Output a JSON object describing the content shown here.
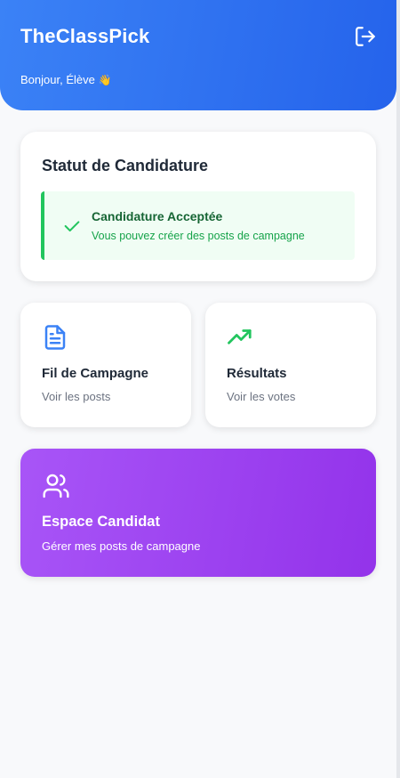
{
  "header": {
    "app_title": "TheClassPick",
    "greeting": "Bonjour, Élève",
    "greeting_emoji": "👋",
    "logout_icon": "logout-icon"
  },
  "status": {
    "title": "Statut de Candidature",
    "heading": "Candidature Acceptée",
    "message": "Vous pouvez créer des posts de campagne",
    "icon": "check-icon",
    "color": "#22c55e"
  },
  "tiles": [
    {
      "title": "Fil de Campagne",
      "subtitle": "Voir les posts",
      "icon": "document-icon",
      "color": "#3b82f6"
    },
    {
      "title": "Résultats",
      "subtitle": "Voir les votes",
      "icon": "trending-up-icon",
      "color": "#22c55e"
    }
  ],
  "candidate": {
    "title": "Espace Candidat",
    "subtitle": "Gérer mes posts de campagne",
    "icon": "users-icon",
    "color": "#a855f7"
  },
  "colors": {
    "header_primary": "#3b82f6",
    "background": "#f8f9fb"
  }
}
